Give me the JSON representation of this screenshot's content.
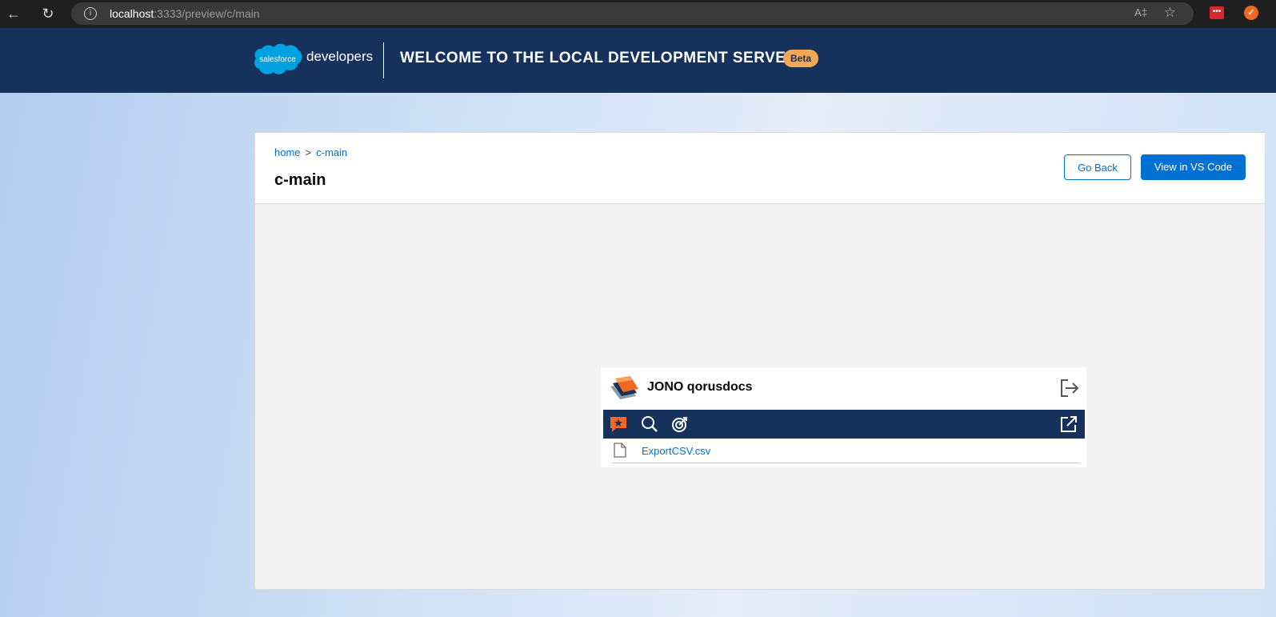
{
  "browser": {
    "url_host": "localhost",
    "url_path": ":3333/preview/c/main"
  },
  "header": {
    "logo_text": "salesforce",
    "brand_suffix": "developers",
    "title": "Welcome to the Local Development Server",
    "badge": "Beta"
  },
  "card": {
    "breadcrumb": [
      "home",
      "c-main"
    ],
    "breadcrumb_sep": ">",
    "title": "c-main",
    "buttons": {
      "back": "Go Back",
      "vscode": "View in VS Code"
    }
  },
  "widget": {
    "name": "JONO qorusdocs",
    "toolbar_icons": [
      "favorite-comment-icon",
      "search-icon",
      "target-icon",
      "external-link-icon"
    ],
    "files": [
      {
        "name": "ExportCSV.csv",
        "icon": "document-icon"
      }
    ]
  },
  "colors": {
    "header_bg": "#16325c",
    "accent": "#0070d2",
    "badge": "#f3a855",
    "widget_orange": "#f26722"
  }
}
